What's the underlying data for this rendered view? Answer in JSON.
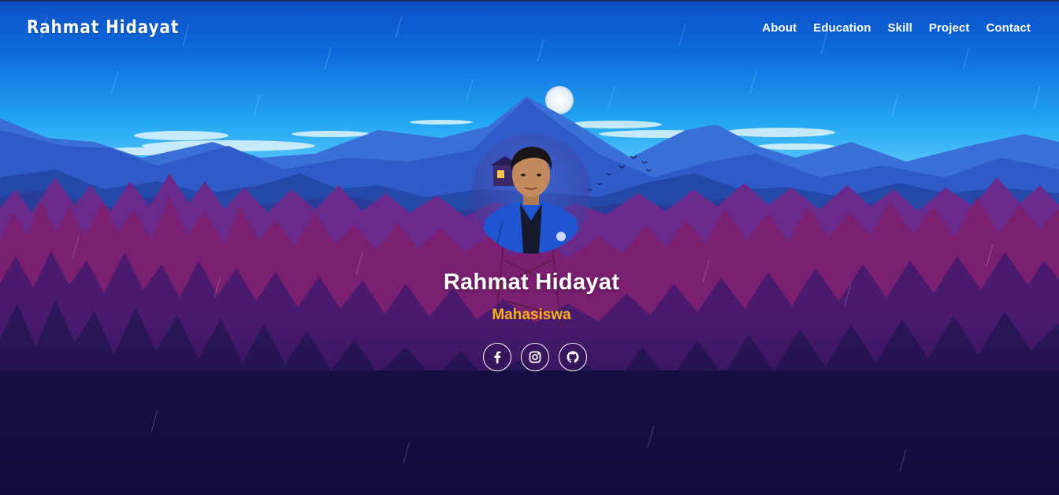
{
  "brand": {
    "name": "Rahmat Hidayat"
  },
  "nav": {
    "items": [
      {
        "label": "About"
      },
      {
        "label": "Education"
      },
      {
        "label": "Skill"
      },
      {
        "label": "Project"
      },
      {
        "label": "Contact"
      }
    ]
  },
  "hero": {
    "name": "Rahmat Hidayat",
    "role": "Mahasiswa",
    "avatar_alt": "profile-photo",
    "socials": [
      {
        "icon": "facebook-icon"
      },
      {
        "icon": "instagram-icon"
      },
      {
        "icon": "github-icon"
      }
    ]
  },
  "colors": {
    "accent": "#f5b41a",
    "text": "#ffffff",
    "background_bottom": "#120b3a",
    "sky_top": "#0a55c8"
  }
}
